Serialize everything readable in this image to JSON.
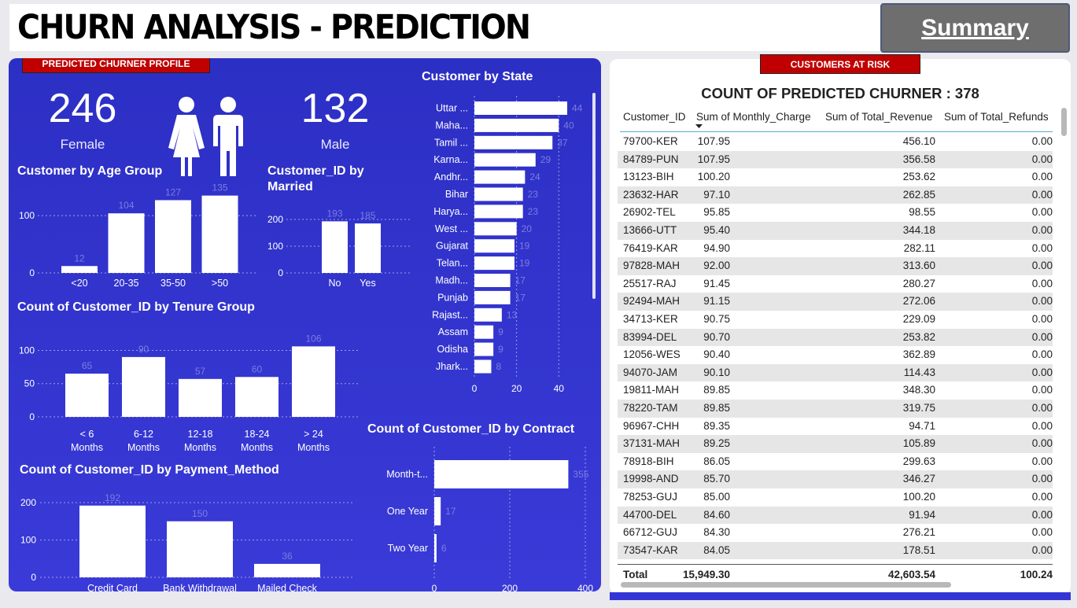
{
  "header": {
    "title": "CHURN ANALYSIS - PREDICTION",
    "summary_button": "Summary"
  },
  "left_panel": {
    "tag": "PREDICTED CHURNER PROFILE",
    "female": {
      "value": "246",
      "label": "Female"
    },
    "male": {
      "value": "132",
      "label": "Male"
    }
  },
  "right_panel": {
    "tag": "CUSTOMERS AT RISK",
    "title": "COUNT OF PREDICTED CHURNER : 378",
    "columns": [
      "Customer_ID",
      "Sum of Monthly_Charge",
      "Sum of Total_Revenue",
      "Sum of Total_Refunds"
    ],
    "rows": [
      [
        "79700-KER",
        "107.95",
        "456.10",
        "0.00"
      ],
      [
        "84789-PUN",
        "107.95",
        "356.58",
        "0.00"
      ],
      [
        "13123-BIH",
        "100.20",
        "253.62",
        "0.00"
      ],
      [
        "23632-HAR",
        "97.10",
        "262.85",
        "0.00"
      ],
      [
        "26902-TEL",
        "95.85",
        "98.55",
        "0.00"
      ],
      [
        "13666-UTT",
        "95.40",
        "344.18",
        "0.00"
      ],
      [
        "76419-KAR",
        "94.90",
        "282.11",
        "0.00"
      ],
      [
        "97828-MAH",
        "92.00",
        "313.60",
        "0.00"
      ],
      [
        "25517-RAJ",
        "91.45",
        "280.27",
        "0.00"
      ],
      [
        "92494-MAH",
        "91.15",
        "272.06",
        "0.00"
      ],
      [
        "34713-KER",
        "90.75",
        "229.09",
        "0.00"
      ],
      [
        "83994-DEL",
        "90.70",
        "253.82",
        "0.00"
      ],
      [
        "12056-WES",
        "90.40",
        "362.89",
        "0.00"
      ],
      [
        "94070-JAM",
        "90.10",
        "114.43",
        "0.00"
      ],
      [
        "19811-MAH",
        "89.85",
        "348.30",
        "0.00"
      ],
      [
        "78220-TAM",
        "89.85",
        "319.75",
        "0.00"
      ],
      [
        "96967-CHH",
        "89.35",
        "94.71",
        "0.00"
      ],
      [
        "37131-MAH",
        "89.25",
        "105.89",
        "0.00"
      ],
      [
        "78918-BIH",
        "86.05",
        "299.63",
        "0.00"
      ],
      [
        "19998-AND",
        "85.70",
        "346.27",
        "0.00"
      ],
      [
        "78253-GUJ",
        "85.00",
        "100.20",
        "0.00"
      ],
      [
        "44700-DEL",
        "84.60",
        "91.94",
        "0.00"
      ],
      [
        "66712-GUJ",
        "84.30",
        "276.21",
        "0.00"
      ],
      [
        "73547-KAR",
        "84.05",
        "178.51",
        "0.00"
      ]
    ],
    "total": [
      "Total",
      "15,949.30",
      "42,603.54",
      "100.24"
    ]
  },
  "chart_data": [
    {
      "id": "age",
      "type": "bar",
      "title": "Customer by Age Group",
      "categories": [
        "<20",
        "20-35",
        "35-50",
        ">50"
      ],
      "values": [
        12,
        104,
        127,
        135
      ],
      "yticks": [
        "0",
        "100"
      ],
      "ylim": [
        0,
        140
      ]
    },
    {
      "id": "married",
      "type": "bar",
      "title": "Customer_ID by Married",
      "categories": [
        "No",
        "Yes"
      ],
      "values": [
        193,
        185
      ],
      "yticks": [
        "0",
        "100",
        "200"
      ],
      "ylim": [
        0,
        200
      ]
    },
    {
      "id": "tenure",
      "type": "bar",
      "title": "Count of Customer_ID by Tenure Group",
      "categories": [
        "< 6 Months",
        "6-12 Months",
        "12-18 Months",
        "18-24 Months",
        "> 24 Months"
      ],
      "values": [
        65,
        90,
        57,
        60,
        106
      ],
      "yticks": [
        "0",
        "50",
        "100"
      ],
      "ylim": [
        0,
        110
      ]
    },
    {
      "id": "payment",
      "type": "bar",
      "title": "Count of Customer_ID by Payment_Method",
      "categories": [
        "Credit Card",
        "Bank Withdrawal",
        "Mailed Check"
      ],
      "values": [
        192,
        150,
        36
      ],
      "yticks": [
        "0",
        "100",
        "200"
      ],
      "ylim": [
        0,
        200
      ]
    },
    {
      "id": "state",
      "type": "bar",
      "orientation": "horizontal",
      "title": "Customer by State",
      "categories": [
        "Uttar ...",
        "Maha...",
        "Tamil ...",
        "Karna...",
        "Andhr...",
        "Bihar",
        "Harya...",
        "West ...",
        "Gujarat",
        "Telan...",
        "Madh...",
        "Punjab",
        "Rajast...",
        "Assam",
        "Odisha",
        "Jhark..."
      ],
      "values": [
        44,
        40,
        37,
        29,
        24,
        23,
        23,
        20,
        19,
        19,
        17,
        17,
        13,
        9,
        9,
        8
      ],
      "xticks": [
        "0",
        "20",
        "40"
      ],
      "xlim": [
        0,
        44
      ]
    },
    {
      "id": "contract",
      "type": "bar",
      "orientation": "horizontal",
      "title": "Count of Customer_ID by Contract",
      "categories": [
        "Month-t...",
        "One Year",
        "Two Year"
      ],
      "values": [
        355,
        17,
        6
      ],
      "xticks": [
        "0",
        "200",
        "400"
      ],
      "xlim": [
        0,
        400
      ]
    }
  ]
}
